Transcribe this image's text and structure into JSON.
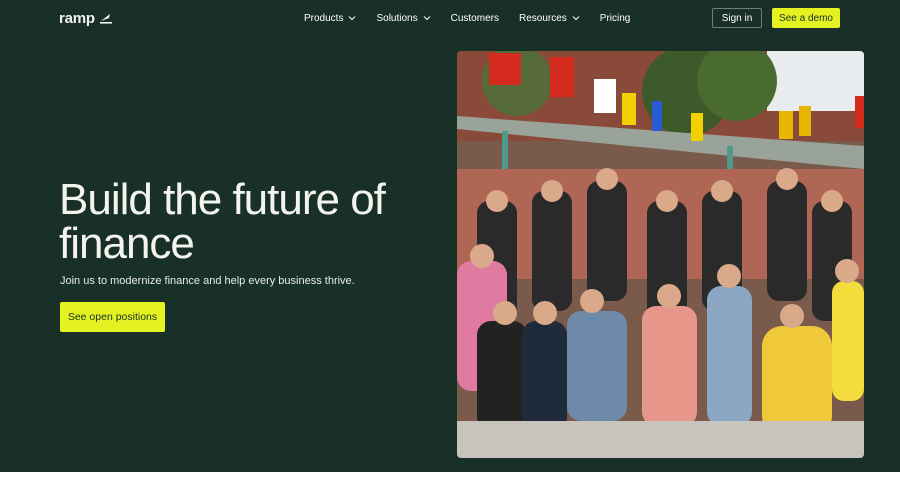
{
  "brand": {
    "name": "ramp",
    "accent": "#e4f222",
    "background": "#183028"
  },
  "nav": {
    "items": [
      {
        "label": "Products",
        "has_dropdown": true
      },
      {
        "label": "Solutions",
        "has_dropdown": true
      },
      {
        "label": "Customers",
        "has_dropdown": false
      },
      {
        "label": "Resources",
        "has_dropdown": true
      },
      {
        "label": "Pricing",
        "has_dropdown": false
      }
    ],
    "sign_in": "Sign in",
    "demo": "See a demo"
  },
  "hero": {
    "headline_line1": "Build the future of",
    "headline_line2": "finance",
    "subline": "Join us to modernize finance and help every business thrive.",
    "cta": "See open positions"
  },
  "photo": {
    "icon": "team-group-photo"
  }
}
